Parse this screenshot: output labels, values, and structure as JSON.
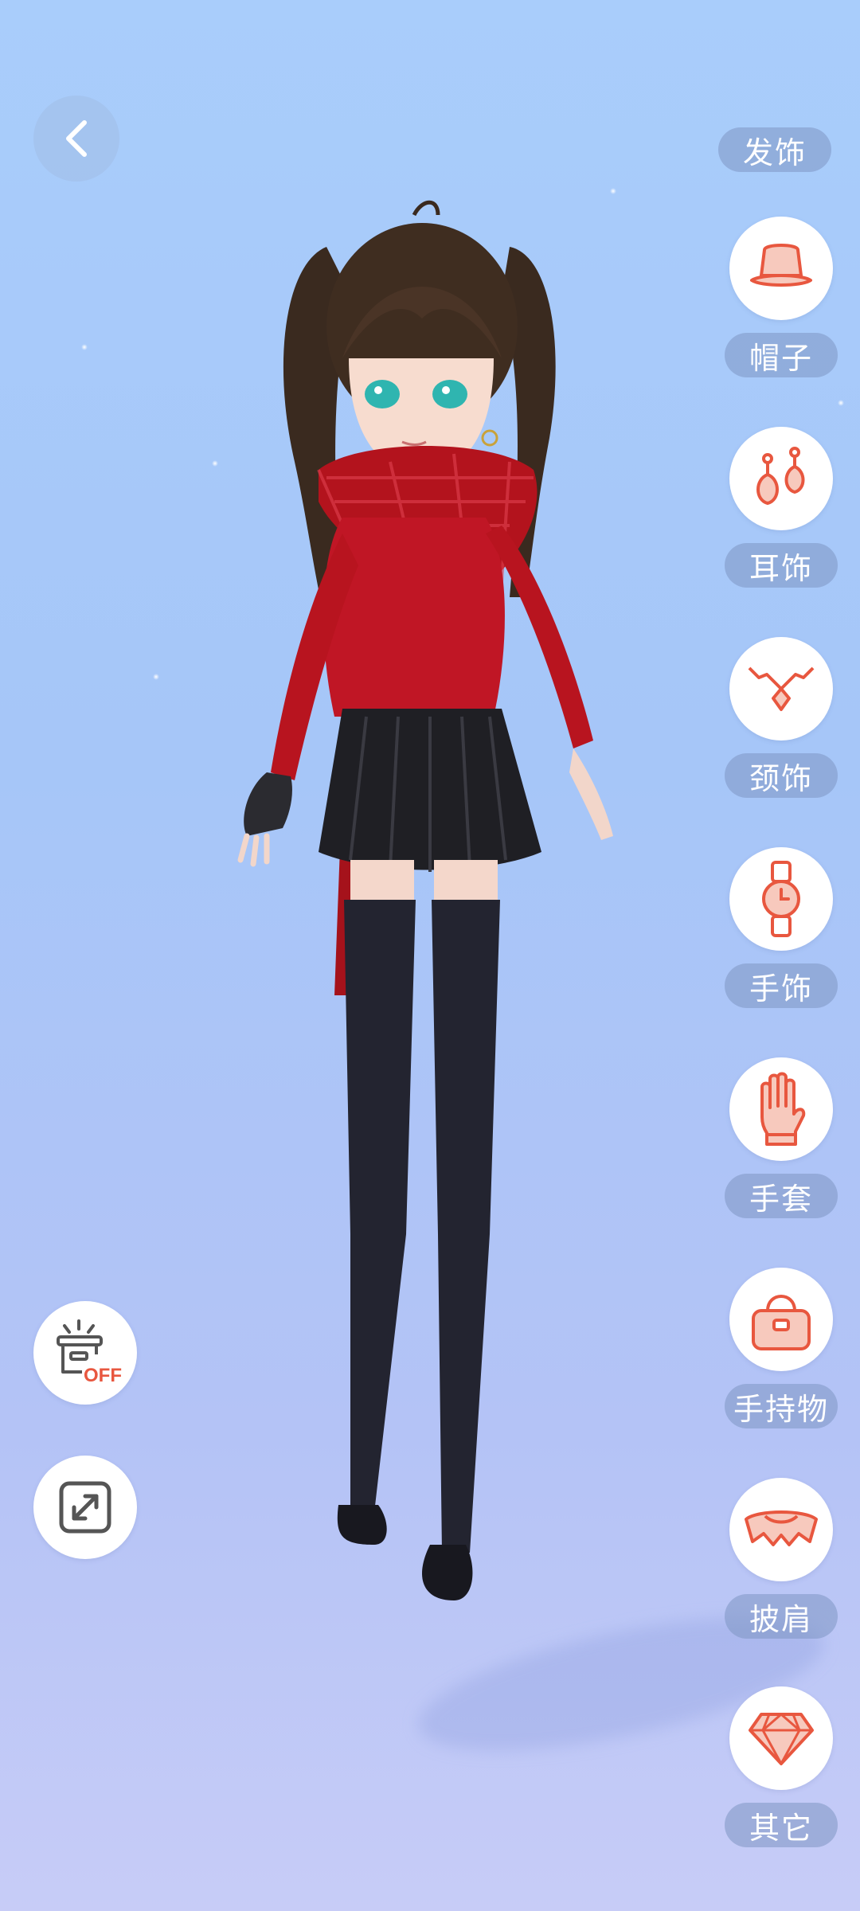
{
  "header": {
    "back_icon": "chevron-left-icon"
  },
  "categories_top_label": "发饰",
  "categories": [
    {
      "id": "hat",
      "label": "帽子",
      "icon": "hat-icon"
    },
    {
      "id": "earrings",
      "label": "耳饰",
      "icon": "earrings-icon"
    },
    {
      "id": "necklace",
      "label": "颈饰",
      "icon": "necklace-icon"
    },
    {
      "id": "wrist",
      "label": "手饰",
      "icon": "watch-icon"
    },
    {
      "id": "gloves",
      "label": "手套",
      "icon": "glove-icon"
    },
    {
      "id": "handheld",
      "label": "手持物",
      "icon": "handbag-icon"
    },
    {
      "id": "shawl",
      "label": "披肩",
      "icon": "shawl-icon"
    },
    {
      "id": "other",
      "label": "其它",
      "icon": "diamond-icon"
    }
  ],
  "left_tools": {
    "light_toggle": {
      "icon": "light-box-icon",
      "state_text": "OFF"
    },
    "expand": {
      "icon": "expand-icon"
    }
  },
  "colors": {
    "accent": "#e8573f",
    "icon_fill": "#f7c9bd"
  }
}
